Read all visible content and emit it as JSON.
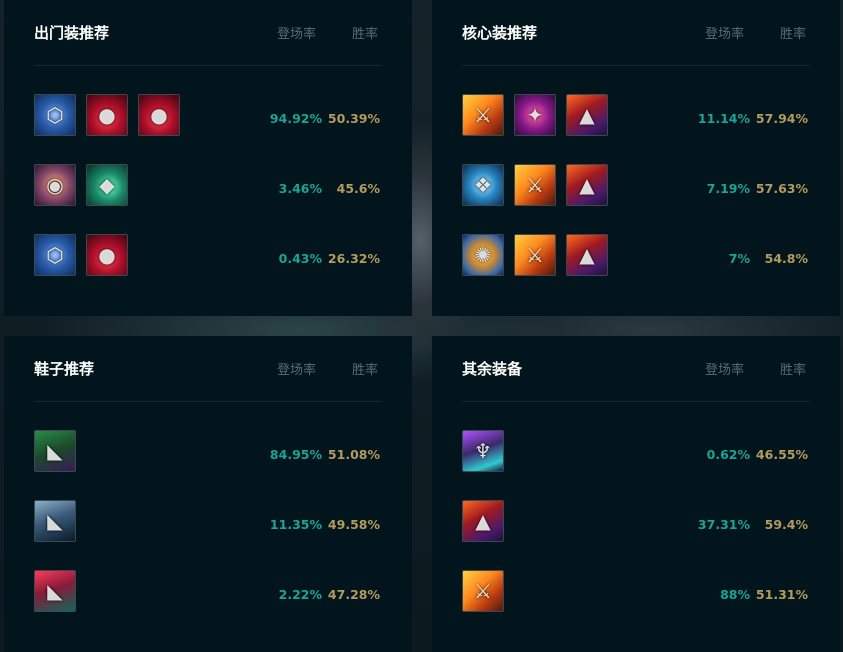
{
  "headers": {
    "pick_rate": "登场率",
    "win_rate": "胜率"
  },
  "panels": [
    {
      "id": "p-start",
      "title": "出门装推荐",
      "rows": [
        {
          "items": [
            "dorans-shield-icon",
            "health-potion-icon",
            "health-potion-icon"
          ],
          "pick": "94.92%",
          "win": "50.39%"
        },
        {
          "items": [
            "corrupting-potion-icon",
            "refillable-potion-icon"
          ],
          "pick": "3.46%",
          "win": "45.6%"
        },
        {
          "items": [
            "dorans-shield-icon",
            "health-potion-icon"
          ],
          "pick": "0.43%",
          "win": "26.32%"
        }
      ]
    },
    {
      "id": "p-core",
      "title": "核心装推荐",
      "rows": [
        {
          "items": [
            "infinity-edge-icon",
            "shadowflame-icon",
            "wizard-hat-icon"
          ],
          "pick": "11.14%",
          "win": "57.94%"
        },
        {
          "items": [
            "nashors-tooth-icon",
            "infinity-edge-icon",
            "wizard-hat-icon"
          ],
          "pick": "7.19%",
          "win": "57.63%"
        },
        {
          "items": [
            "stormsurge-icon",
            "infinity-edge-icon",
            "wizard-hat-icon"
          ],
          "pick": "7%",
          "win": "54.8%"
        }
      ]
    },
    {
      "id": "p-boots",
      "title": "鞋子推荐",
      "rows": [
        {
          "items": [
            "sorcerers-shoes-icon"
          ],
          "pick": "84.95%",
          "win": "51.08%"
        },
        {
          "items": [
            "plated-steelcaps-icon"
          ],
          "pick": "11.35%",
          "win": "49.58%"
        },
        {
          "items": [
            "mercury-treads-icon"
          ],
          "pick": "2.22%",
          "win": "47.28%"
        }
      ]
    },
    {
      "id": "p-other",
      "title": "其余装备",
      "rows": [
        {
          "items": [
            "void-staff-icon"
          ],
          "pick": "0.62%",
          "win": "46.55%"
        },
        {
          "items": [
            "wizard-hat-icon"
          ],
          "pick": "37.31%",
          "win": "59.4%"
        },
        {
          "items": [
            "infinity-edge-icon"
          ],
          "pick": "88%",
          "win": "51.31%"
        }
      ]
    }
  ],
  "icon_styles": {
    "dorans-shield-icon": {
      "bg": "radial-gradient(circle at 50% 50%, #9fc4ff 0%, #2a5fae 45%, #0d2c5c 100%)",
      "glyph": "⬡"
    },
    "health-potion-icon": {
      "bg": "radial-gradient(circle at 50% 60%, #ff4a5a 0%, #b0102a 45%, #3c0410 100%)",
      "glyph": "●"
    },
    "corrupting-potion-icon": {
      "bg": "radial-gradient(circle at 50% 50%, #ffb070 0%, #8a4a6a 50%, #2c1430 100%)",
      "glyph": "◉"
    },
    "refillable-potion-icon": {
      "bg": "radial-gradient(circle at 55% 55%, #6affc8 0%, #1a8a6a 45%, #082a22 100%)",
      "glyph": "◆"
    },
    "infinity-edge-icon": {
      "bg": "linear-gradient(135deg, #ffd040 0%, #ff8a20 40%, #b83a10 70%, #4a1a10 100%)",
      "glyph": "⚔"
    },
    "shadowflame-icon": {
      "bg": "radial-gradient(circle at 50% 50%, #ff60a0 0%, #8a1a8a 50%, #2a0a3a 100%)",
      "glyph": "✦"
    },
    "wizard-hat-icon": {
      "bg": "linear-gradient(150deg, #ff6a20 0%, #a01a20 40%, #4a1a6a 75%, #20103a 100%)",
      "glyph": "▲"
    },
    "nashors-tooth-icon": {
      "bg": "radial-gradient(circle at 50% 50%, #c0f0ff 0%, #2a8ac8 45%, #0a2a4a 100%)",
      "glyph": "❖"
    },
    "stormsurge-icon": {
      "bg": "radial-gradient(circle at 50% 50%, #ffe080 0%, #d08a30 40%, #3a6aaa 75%, #10204a 100%)",
      "glyph": "✺"
    },
    "sorcerers-shoes-icon": {
      "bg": "linear-gradient(160deg, #2a8a4a 0%, #1a4a2a 50%, #3a1a5a 100%)",
      "glyph": "◣"
    },
    "plated-steelcaps-icon": {
      "bg": "linear-gradient(160deg, #8ab0c8 0%, #3a5a7a 45%, #0a1a2a 100%)",
      "glyph": "◣"
    },
    "mercury-treads-icon": {
      "bg": "linear-gradient(160deg, #ff3a5a 0%, #8a1a3a 45%, #0a6a5a 100%)",
      "glyph": "◣"
    },
    "void-staff-icon": {
      "bg": "linear-gradient(160deg, #b050ff 0%, #3a2a6a 45%, #30c8d0 80%, #1a1a3a 100%)",
      "glyph": "♆"
    }
  }
}
